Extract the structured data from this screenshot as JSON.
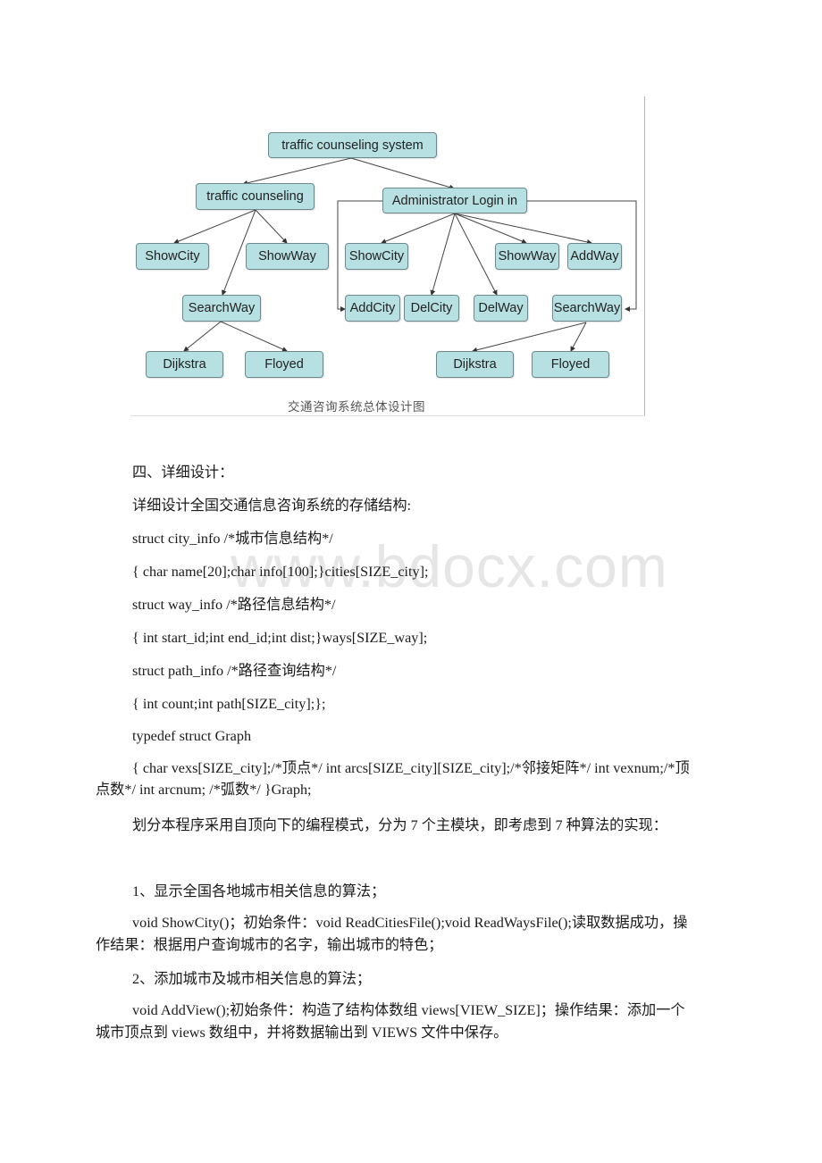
{
  "diagram": {
    "nodes": {
      "root": "traffic counseling system",
      "traffic_counseling": "traffic counseling",
      "admin_login": "Administrator Login in",
      "tc_showcity": "ShowCity",
      "tc_showway": "ShowWay",
      "tc_searchway": "SearchWay",
      "tc_dijkstra": "Dijkstra",
      "tc_floyed": "Floyed",
      "ad_showcity": "ShowCity",
      "ad_showway": "ShowWay",
      "ad_addway": "AddWay",
      "ad_addcity": "AddCity",
      "ad_delcity": "DelCity",
      "ad_delway": "DelWay",
      "ad_searchway": "SearchWay",
      "ad_dijkstra": "Dijkstra",
      "ad_floyed": "Floyed"
    },
    "caption": "交通咨询系统总体设计图"
  },
  "watermark": "www.bdocx.com",
  "section": {
    "heading": "四、详细设计：",
    "intro": "详细设计全国交通信息咨询系统的存储结构:",
    "code_lines": [
      "struct city_info /*城市信息结构*/",
      "{ char name[20];char info[100];}cities[SIZE_city];",
      " struct way_info /*路径信息结构*/",
      "{ int start_id;int end_id;int dist;}ways[SIZE_way];",
      "struct path_info /*路径查询结构*/",
      "{ int count;int path[SIZE_city];};",
      "typedef struct Graph"
    ],
    "graph_def": "{ char vexs[SIZE_city];/*顶点*/ int arcs[SIZE_city][SIZE_city];/*邻接矩阵*/ int vexnum;/*顶点数*/ int arcnum; /*弧数*/ }Graph;",
    "modules_intro": "划分本程序采用自顶向下的编程模式，分为 7 个主模块，即考虑到 7 种算法的实现：",
    "item1_title": "1、显示全国各地城市相关信息的算法；",
    "item1_body": "void ShowCity()；初始条件：void ReadCitiesFile();void ReadWaysFile();读取数据成功，操作结果：根据用户查询城市的名字，输出城市的特色；",
    "item2_title": "2、添加城市及城市相关信息的算法；",
    "item2_body": "void AddView();初始条件：构造了结构体数组 views[VIEW_SIZE]；操作结果：添加一个城市顶点到 views 数组中，并将数据输出到 VIEWS 文件中保存。"
  }
}
